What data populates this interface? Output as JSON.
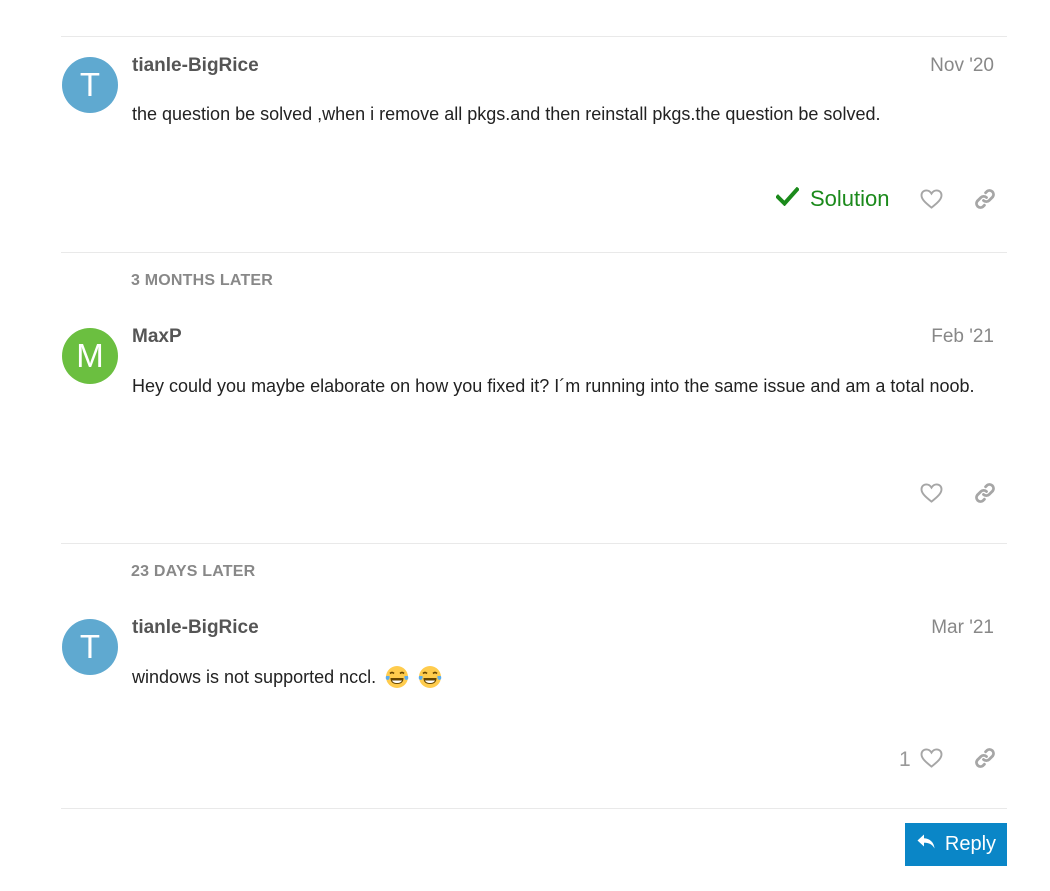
{
  "posts": [
    {
      "avatar_letter": "T",
      "avatar_color": "#5fa9d0",
      "username": "tianle-BigRice",
      "date": "Nov '20",
      "body": "the question be solved ,when i remove all pkgs.and then reinstall pkgs.the question be solved.",
      "solution_label": "Solution"
    },
    {
      "avatar_letter": "M",
      "avatar_color": "#6bbf40",
      "username": "MaxP",
      "date": "Feb '21",
      "body": "Hey could you maybe elaborate on how you fixed it? I´m running into the same issue and am a total noob."
    },
    {
      "avatar_letter": "T",
      "avatar_color": "#5fa9d0",
      "username": "tianle-BigRice",
      "date": "Mar '21",
      "body": "windows is not supported nccl.",
      "like_count": "1"
    }
  ],
  "gaps": [
    {
      "label": "3 MONTHS LATER"
    },
    {
      "label": "23 DAYS LATER"
    }
  ],
  "icons": {
    "solution": "check-icon",
    "like": "heart-icon",
    "share": "link-icon",
    "reply": "reply-arrow-icon",
    "emoji": "joy-emoji"
  },
  "colors": {
    "solution": "#1b8a1b",
    "reply_button": "#0a86c7"
  },
  "reply_button": {
    "label": "Reply"
  }
}
